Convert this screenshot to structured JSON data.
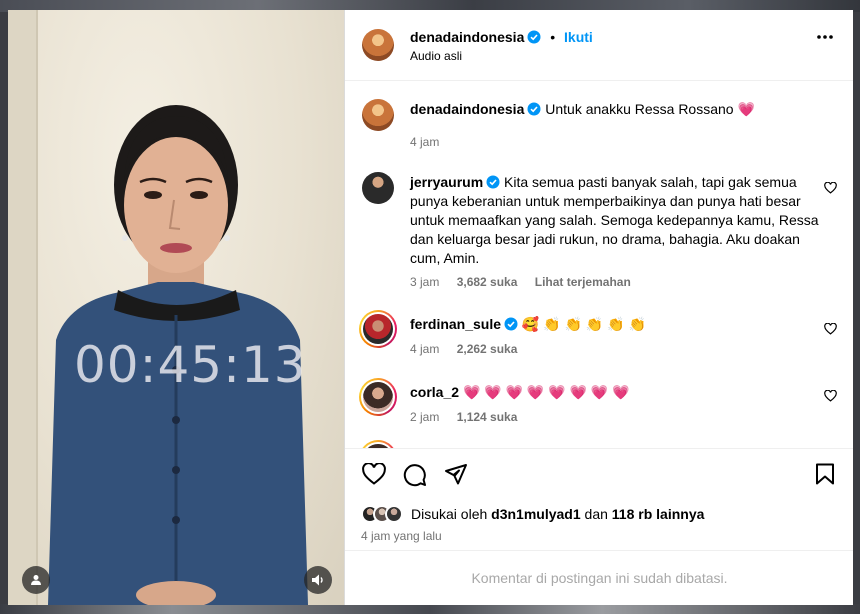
{
  "video": {
    "timer": "00:45:13"
  },
  "header": {
    "username": "denadaindonesia",
    "separator": "•",
    "follow_label": "Ikuti",
    "audio_label": "Audio asli"
  },
  "caption": {
    "username": "denadaindonesia",
    "text": "Untuk anakku Ressa Rossano",
    "emoji": "💗",
    "time": "4 jam"
  },
  "comments": [
    {
      "username": "jerryaurum",
      "text": "Kita semua pasti banyak salah, tapi gak semua punya keberanian untuk memperbaikinya dan punya hati besar untuk memaafkan yang salah. Semoga kedepannya kamu, Ressa dan keluarga besar jadi rukun, no drama, bahagia. Aku doakan cum, Amin.",
      "time": "3 jam",
      "likes": "3,682 suka",
      "translate": "Lihat terjemahan"
    },
    {
      "username": "ferdinan_sule",
      "text": "🥰 👏 👏 👏 👏 👏",
      "time": "4 jam",
      "likes": "2,262 suka"
    },
    {
      "username": "corla_2",
      "text": "💗 💗 💗 💗 💗 💗 💗 💗",
      "time": "2 jam",
      "likes": "1,124 suka"
    }
  ],
  "likes": {
    "prefix": "Disukai oleh",
    "user": "d3n1mulyad1",
    "middle": "dan",
    "others": "118 rb lainnya"
  },
  "time_ago": "4 jam yang lalu",
  "footer_text": "Komentar di postingan ini sudah dibatasi.",
  "colors": {
    "link": "#0095f6",
    "verified": "#0095f6",
    "muted": "#737373",
    "heart": "#ef3e71"
  },
  "icons": [
    "more-icon",
    "like-icon",
    "comment-icon",
    "share-icon",
    "save-icon",
    "verified-icon",
    "user-icon",
    "speaker-icon",
    "heart-icon"
  ]
}
